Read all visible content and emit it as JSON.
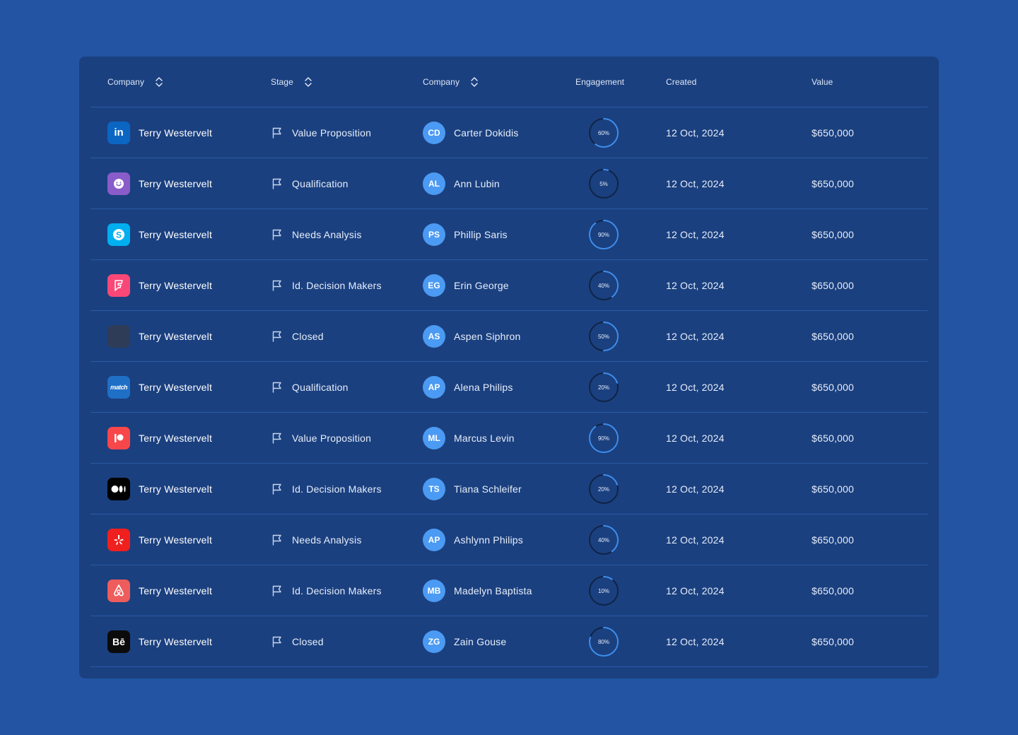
{
  "header": {
    "col1": "Company",
    "col2": "Stage",
    "col3": "Company",
    "col4": "Engagement",
    "col5": "Created",
    "col6": "Value"
  },
  "colors": {
    "background": "#2354a4",
    "card": "#1b407f",
    "divider": "#2a5aa6",
    "avatar": "#4b9af3",
    "ring_track": "#0f2447",
    "ring_progress": "#3e8ff0"
  },
  "rows": [
    {
      "company": "Terry Westervelt",
      "logo": "linkedin-icon",
      "logo_text": "in",
      "logo_color": "#0a66c2",
      "stage": "Value Proposition",
      "initials": "CD",
      "contact": "Carter Dokidis",
      "engagement": 60,
      "engagement_label": "60%",
      "created": "12 Oct, 2024",
      "value": "$650,000"
    },
    {
      "company": "Terry Westervelt",
      "logo": "chat-bubble-icon",
      "logo_text": "",
      "logo_color": "#8a5cc9",
      "stage": "Qualification",
      "initials": "AL",
      "contact": "Ann Lubin",
      "engagement": 5,
      "engagement_label": "5%",
      "created": "12 Oct, 2024",
      "value": "$650,000"
    },
    {
      "company": "Terry Westervelt",
      "logo": "skype-icon",
      "logo_text": "S",
      "logo_color": "#00aff0",
      "stage": "Needs Analysis",
      "initials": "PS",
      "contact": "Phillip Saris",
      "engagement": 90,
      "engagement_label": "90%",
      "created": "12 Oct, 2024",
      "value": "$650,000"
    },
    {
      "company": "Terry Westervelt",
      "logo": "foursquare-icon",
      "logo_text": "F",
      "logo_color": "#f94877",
      "stage": "Id. Decision Makers",
      "initials": "EG",
      "contact": "Erin George",
      "engagement": 40,
      "engagement_label": "40%",
      "created": "12 Oct, 2024",
      "value": "$650,000"
    },
    {
      "company": "Terry Westervelt",
      "logo": "blank-logo-icon",
      "logo_text": "",
      "logo_color": "#2f3c57",
      "stage": "Closed",
      "initials": "AS",
      "contact": "Aspen Siphron",
      "engagement": 50,
      "engagement_label": "50%",
      "created": "12 Oct, 2024",
      "value": "$650,000"
    },
    {
      "company": "Terry Westervelt",
      "logo": "match-icon",
      "logo_text": "match",
      "logo_color": "#1f6fc7",
      "stage": "Qualification",
      "initials": "AP",
      "contact": "Alena Philips",
      "engagement": 20,
      "engagement_label": "20%",
      "created": "12 Oct, 2024",
      "value": "$650,000"
    },
    {
      "company": "Terry Westervelt",
      "logo": "patreon-icon",
      "logo_text": "",
      "logo_color": "#f8474a",
      "stage": "Value Proposition",
      "initials": "ML",
      "contact": "Marcus Levin",
      "engagement": 90,
      "engagement_label": "90%",
      "created": "12 Oct, 2024",
      "value": "$650,000"
    },
    {
      "company": "Terry Westervelt",
      "logo": "medium-icon",
      "logo_text": "",
      "logo_color": "#000000",
      "stage": "Id. Decision Makers",
      "initials": "TS",
      "contact": "Tiana Schleifer",
      "engagement": 20,
      "engagement_label": "20%",
      "created": "12 Oct, 2024",
      "value": "$650,000"
    },
    {
      "company": "Terry Westervelt",
      "logo": "yelp-icon",
      "logo_text": "",
      "logo_color": "#f0201e",
      "stage": "Needs Analysis",
      "initials": "AP",
      "contact": "Ashlynn Philips",
      "engagement": 40,
      "engagement_label": "40%",
      "created": "12 Oct, 2024",
      "value": "$650,000"
    },
    {
      "company": "Terry Westervelt",
      "logo": "airbnb-icon",
      "logo_text": "",
      "logo_color": "#ee5c5c",
      "stage": "Id. Decision Makers",
      "initials": "MB",
      "contact": "Madelyn Baptista",
      "engagement": 10,
      "engagement_label": "10%",
      "created": "12 Oct, 2024",
      "value": "$650,000"
    },
    {
      "company": "Terry Westervelt",
      "logo": "behance-icon",
      "logo_text": "Bē",
      "logo_color": "#0b0b0b",
      "stage": "Closed",
      "initials": "ZG",
      "contact": "Zain Gouse",
      "engagement": 80,
      "engagement_label": "80%",
      "created": "12 Oct, 2024",
      "value": "$650,000"
    }
  ]
}
